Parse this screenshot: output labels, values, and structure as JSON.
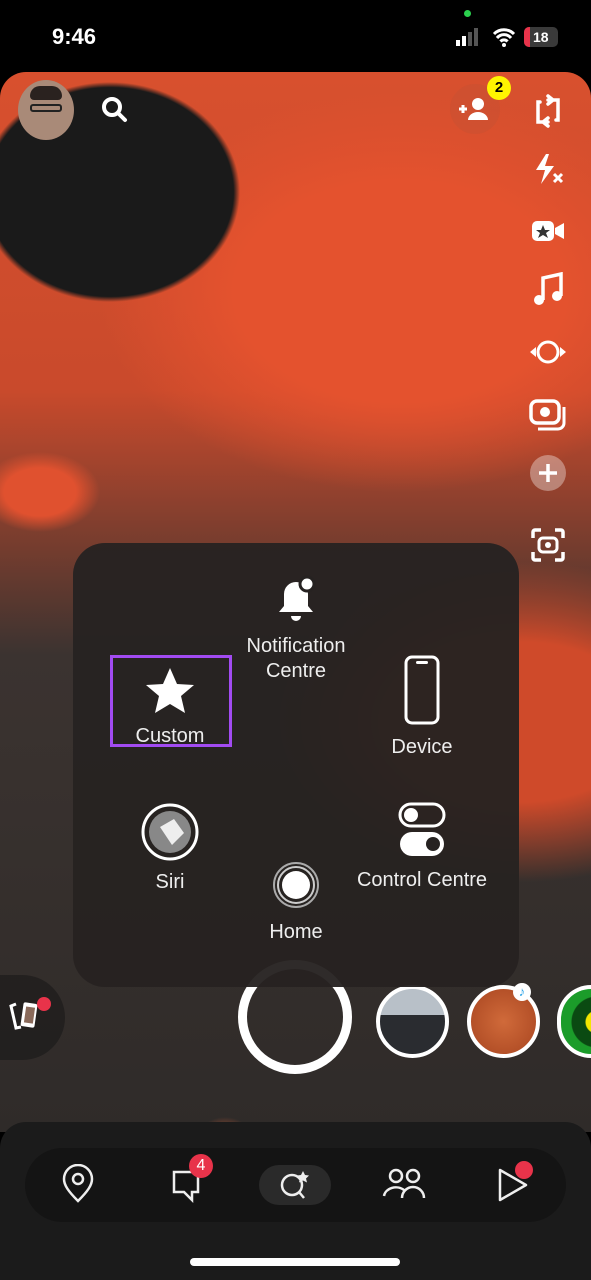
{
  "status_bar": {
    "time": "9:46",
    "battery": "18"
  },
  "camera": {
    "friend_requests_badge": "2"
  },
  "assistive_touch": {
    "items": [
      {
        "label": "Notification Centre",
        "icon": "bell-icon"
      },
      {
        "label": "Custom",
        "icon": "star-icon"
      },
      {
        "label": "Device",
        "icon": "device-icon"
      },
      {
        "label": "Siri",
        "icon": "siri-icon"
      },
      {
        "label": "Home",
        "icon": "home-icon"
      },
      {
        "label": "Control Centre",
        "icon": "control-centre-icon"
      }
    ],
    "highlight_color": "#a24bf2"
  },
  "bottom_nav": {
    "chat_badge": "4",
    "items": [
      "map",
      "chat",
      "camera-spotlight",
      "stories",
      "spotlight"
    ],
    "badge_color": "#e8334a"
  }
}
